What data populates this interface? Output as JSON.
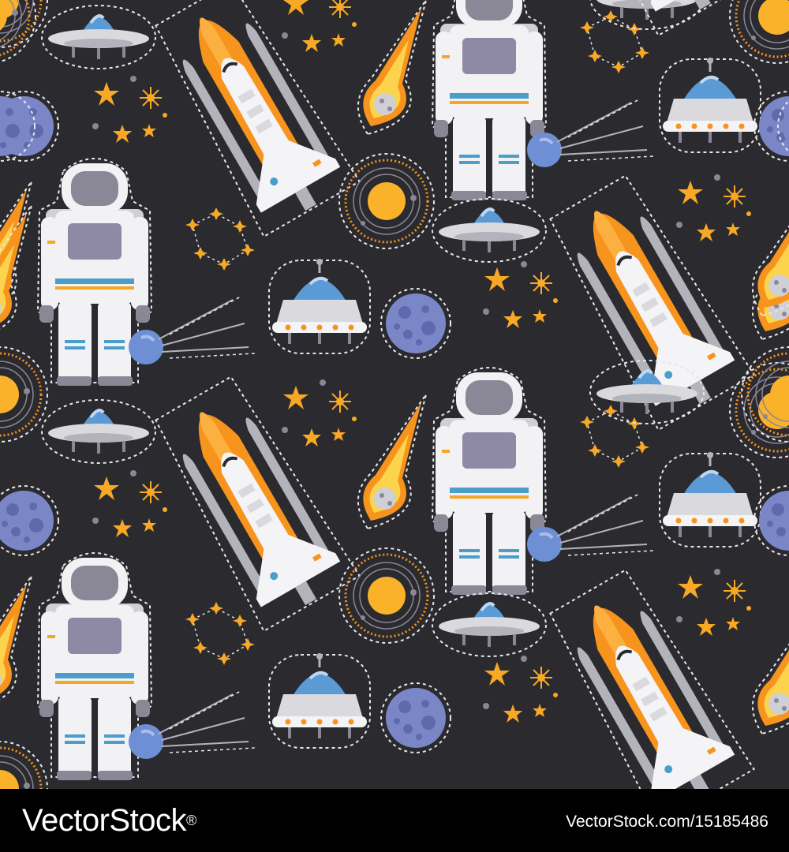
{
  "colors": {
    "background": "#2b2b2f",
    "sticker_outline": "#e8e8ea",
    "suit_white": "#f2f2f4",
    "suit_shade": "#cfcfd6",
    "visor": "#8a8797",
    "chest_panel": "#8e8aa6",
    "stripe_blue": "#4a9ec9",
    "stripe_orange": "#f5a623",
    "tank_orange": "#f7941d",
    "tank_light": "#fbb040",
    "booster_gray": "#b3b3bb",
    "hull_white": "#f4f4f6",
    "ufo_dome": "#5b9bd5",
    "ufo_body": "#d9d9de",
    "ufo_lights": "#f7941d",
    "planet_blue": "#7b86c7",
    "planet_crater": "#5f69ad",
    "sun_yellow": "#fbb22b",
    "sun_ring": "#f7941d",
    "star_yellow": "#f9a825",
    "comet_orange": "#f7941d",
    "comet_core": "#fbd34d",
    "satellite_blue": "#6e8fd4"
  },
  "pattern": {
    "motifs": [
      "astronaut-icon",
      "space-shuttle-icon",
      "ufo-saucer-icon",
      "ufo-capsule-icon",
      "blue-planet-icon",
      "sun-icon",
      "comet-icon",
      "satellite-icon",
      "star-cluster-icon",
      "constellation-icon"
    ]
  },
  "footer": {
    "logo_text": "VectorStock",
    "logo_mark": "®",
    "url": "VectorStock.com/15185486"
  }
}
